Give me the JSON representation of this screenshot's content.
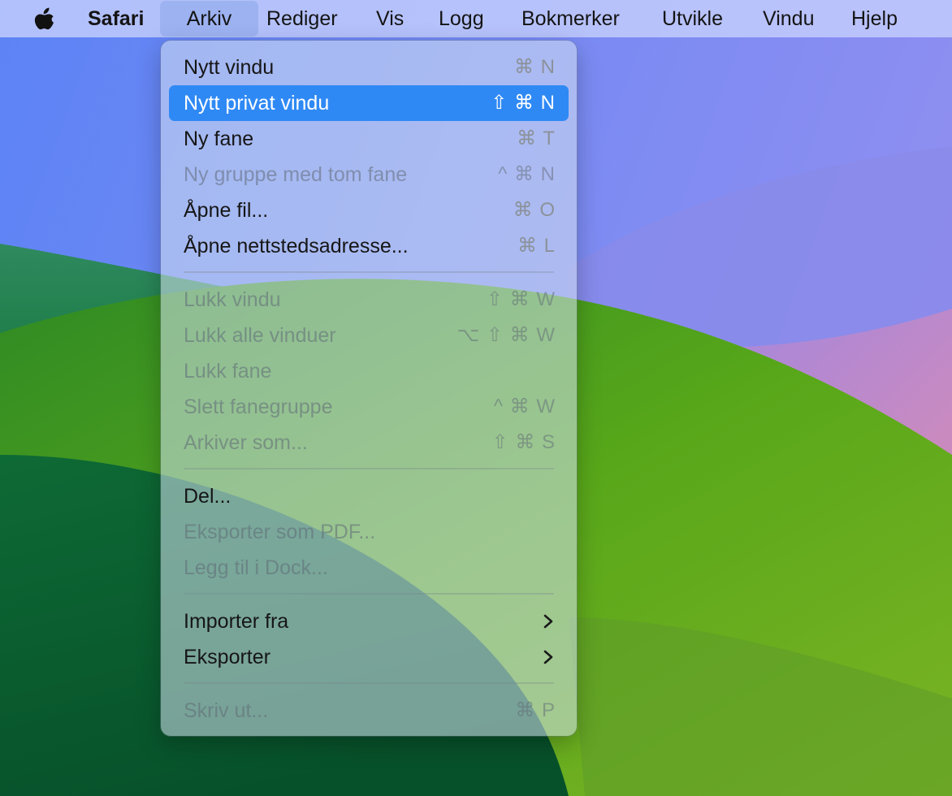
{
  "menubar": {
    "apple_icon": "apple-logo-icon",
    "app_name": "Safari",
    "items": [
      "Arkiv",
      "Rediger",
      "Vis",
      "Logg",
      "Bokmerker",
      "Utvikle",
      "Vindu",
      "Hjelp"
    ],
    "active_item": "Arkiv"
  },
  "menu": {
    "items": [
      {
        "label": "Nytt vindu",
        "shortcut": "⌘ N",
        "enabled": true
      },
      {
        "label": "Nytt privat vindu",
        "shortcut": "⇧ ⌘ N",
        "enabled": true,
        "highlighted": true
      },
      {
        "label": "Ny fane",
        "shortcut": "⌘ T",
        "enabled": true
      },
      {
        "label": "Ny gruppe med tom fane",
        "shortcut": "^ ⌘ N",
        "enabled": false
      },
      {
        "label": "Åpne fil...",
        "shortcut": "⌘ O",
        "enabled": true
      },
      {
        "label": "Åpne nettstedsadresse...",
        "shortcut": "⌘ L",
        "enabled": true
      },
      {
        "label": "Lukk vindu",
        "shortcut": "⇧ ⌘ W",
        "enabled": false
      },
      {
        "label": "Lukk alle vinduer",
        "shortcut": "⌥ ⇧ ⌘ W",
        "enabled": false
      },
      {
        "label": "Lukk fane",
        "shortcut": "",
        "enabled": false
      },
      {
        "label": "Slett fanegruppe",
        "shortcut": "^ ⌘ W",
        "enabled": false
      },
      {
        "label": "Arkiver som...",
        "shortcut": "⇧ ⌘ S",
        "enabled": false
      },
      {
        "label": "Del...",
        "shortcut": "",
        "enabled": true
      },
      {
        "label": "Eksporter som PDF...",
        "shortcut": "",
        "enabled": false
      },
      {
        "label": "Legg til i Dock...",
        "shortcut": "",
        "enabled": false
      },
      {
        "label": "Importer fra",
        "shortcut": "",
        "enabled": true,
        "submenu_icon": "chevron-right-icon"
      },
      {
        "label": "Eksporter",
        "shortcut": "",
        "enabled": true,
        "submenu_icon": "chevron-right-icon"
      },
      {
        "label": "Skriv ut...",
        "shortcut": "⌘ P",
        "enabled": false
      }
    ]
  },
  "colors": {
    "highlight": "#2f89f5",
    "menubar": "#c4cefc",
    "sky": "#6f86f4",
    "hill_green": "#3f9a1f",
    "hill_dark": "#0b5a2c",
    "hill_pink": "#c48ac6"
  }
}
